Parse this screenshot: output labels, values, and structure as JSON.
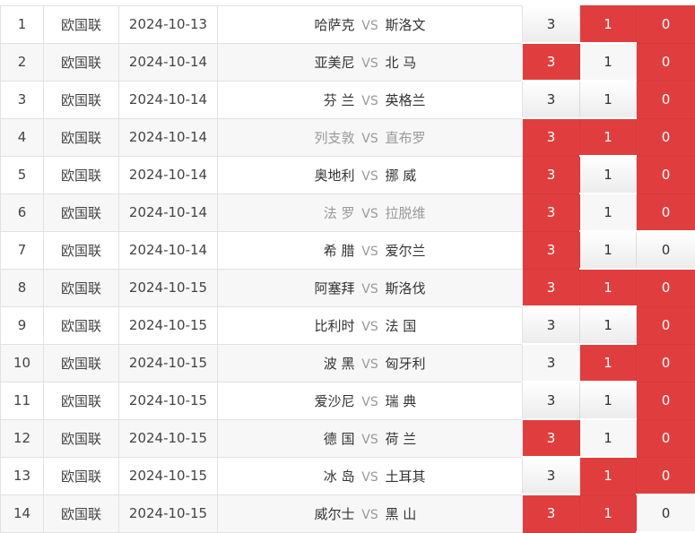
{
  "rows": [
    {
      "no": "1",
      "league": "欧国联",
      "date": "2024-10-13",
      "home": "哈萨克",
      "away": "斯洛文",
      "vs": "VS",
      "opts": [
        "3",
        "1",
        "0"
      ],
      "sel": [
        false,
        true,
        true
      ],
      "grey": false
    },
    {
      "no": "2",
      "league": "欧国联",
      "date": "2024-10-14",
      "home": "亚美尼",
      "away": "北 马",
      "vs": "VS",
      "opts": [
        "3",
        "1",
        "0"
      ],
      "sel": [
        true,
        false,
        true
      ],
      "grey": false
    },
    {
      "no": "3",
      "league": "欧国联",
      "date": "2024-10-14",
      "home": "芬 兰",
      "away": "英格兰",
      "vs": "VS",
      "opts": [
        "3",
        "1",
        "0"
      ],
      "sel": [
        false,
        false,
        true
      ],
      "grey": false
    },
    {
      "no": "4",
      "league": "欧国联",
      "date": "2024-10-14",
      "home": "列支敦",
      "away": "直布罗",
      "vs": "VS",
      "opts": [
        "3",
        "1",
        "0"
      ],
      "sel": [
        true,
        true,
        true
      ],
      "grey": true
    },
    {
      "no": "5",
      "league": "欧国联",
      "date": "2024-10-14",
      "home": "奥地利",
      "away": "挪 威",
      "vs": "VS",
      "opts": [
        "3",
        "1",
        "0"
      ],
      "sel": [
        true,
        false,
        true
      ],
      "grey": false
    },
    {
      "no": "6",
      "league": "欧国联",
      "date": "2024-10-14",
      "home": "法 罗",
      "away": "拉脱维",
      "vs": "VS",
      "opts": [
        "3",
        "1",
        "0"
      ],
      "sel": [
        true,
        false,
        true
      ],
      "grey": true
    },
    {
      "no": "7",
      "league": "欧国联",
      "date": "2024-10-14",
      "home": "希 腊",
      "away": "爱尔兰",
      "vs": "VS",
      "opts": [
        "3",
        "1",
        "0"
      ],
      "sel": [
        true,
        false,
        false
      ],
      "grey": false
    },
    {
      "no": "8",
      "league": "欧国联",
      "date": "2024-10-15",
      "home": "阿塞拜",
      "away": "斯洛伐",
      "vs": "VS",
      "opts": [
        "3",
        "1",
        "0"
      ],
      "sel": [
        true,
        true,
        true
      ],
      "grey": false
    },
    {
      "no": "9",
      "league": "欧国联",
      "date": "2024-10-15",
      "home": "比利时",
      "away": "法 国",
      "vs": "VS",
      "opts": [
        "3",
        "1",
        "0"
      ],
      "sel": [
        false,
        false,
        true
      ],
      "grey": false
    },
    {
      "no": "10",
      "league": "欧国联",
      "date": "2024-10-15",
      "home": "波 黑",
      "away": "匈牙利",
      "vs": "VS",
      "opts": [
        "3",
        "1",
        "0"
      ],
      "sel": [
        false,
        true,
        true
      ],
      "grey": false
    },
    {
      "no": "11",
      "league": "欧国联",
      "date": "2024-10-15",
      "home": "爱沙尼",
      "away": "瑞 典",
      "vs": "VS",
      "opts": [
        "3",
        "1",
        "0"
      ],
      "sel": [
        false,
        false,
        true
      ],
      "grey": false
    },
    {
      "no": "12",
      "league": "欧国联",
      "date": "2024-10-15",
      "home": "德 国",
      "away": "荷 兰",
      "vs": "VS",
      "opts": [
        "3",
        "1",
        "0"
      ],
      "sel": [
        true,
        false,
        true
      ],
      "grey": false
    },
    {
      "no": "13",
      "league": "欧国联",
      "date": "2024-10-15",
      "home": "冰 岛",
      "away": "土耳其",
      "vs": "VS",
      "opts": [
        "3",
        "1",
        "0"
      ],
      "sel": [
        false,
        true,
        true
      ],
      "grey": false
    },
    {
      "no": "14",
      "league": "欧国联",
      "date": "2024-10-15",
      "home": "威尔士",
      "away": "黑 山",
      "vs": "VS",
      "opts": [
        "3",
        "1",
        "0"
      ],
      "sel": [
        true,
        true,
        false
      ],
      "grey": false
    }
  ],
  "colors": {
    "selected": "#e03e3e",
    "grey_team": "#999999"
  }
}
